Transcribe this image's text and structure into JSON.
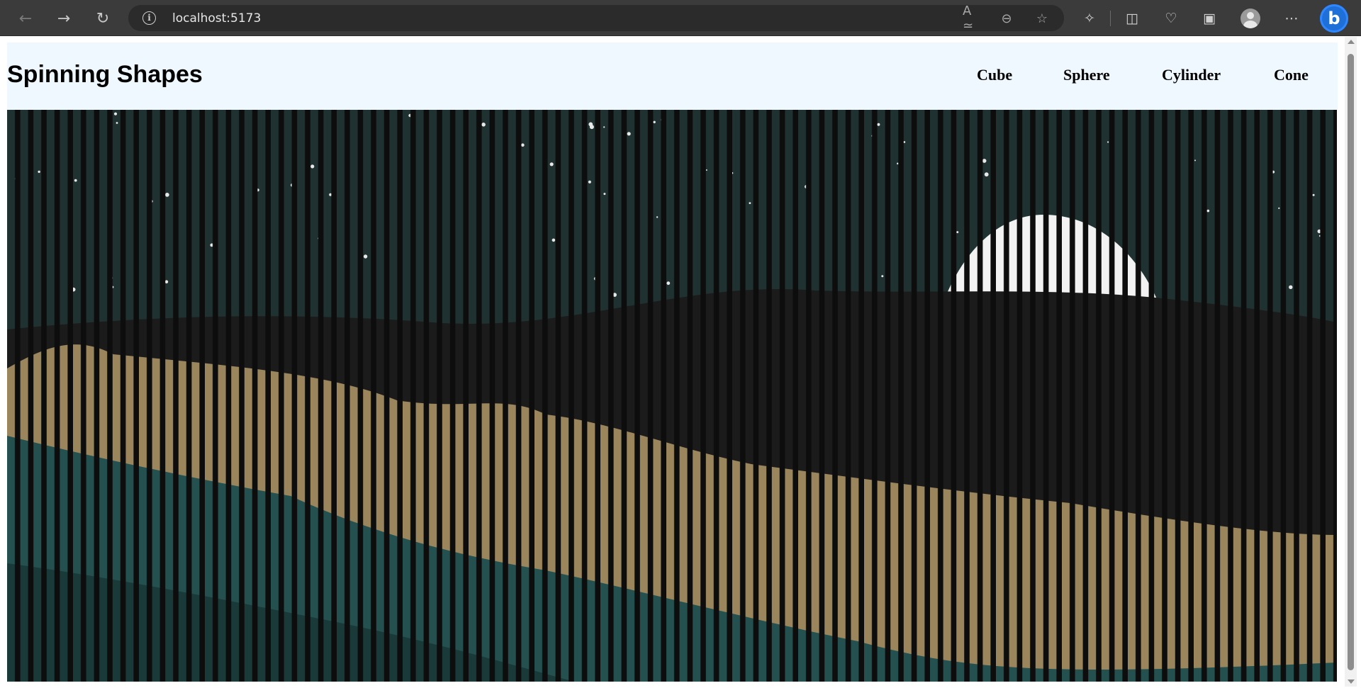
{
  "browser": {
    "url": "localhost:5173",
    "back_icon": "arrow-left-icon",
    "forward_icon": "arrow-right-icon",
    "refresh_icon": "refresh-icon"
  },
  "page": {
    "title": "Spinning Shapes",
    "nav": [
      "Cube",
      "Sphere",
      "Cylinder",
      "Cone"
    ],
    "header_bg": "#f0f8ff"
  },
  "hero": {
    "colors": {
      "sky": "#1f3130",
      "hills_dark": "#1b1b1b",
      "sand": "#9a855c",
      "sea": "#24504f",
      "moon": "#f2f2f2",
      "stripe": "#0d0d0d"
    }
  }
}
